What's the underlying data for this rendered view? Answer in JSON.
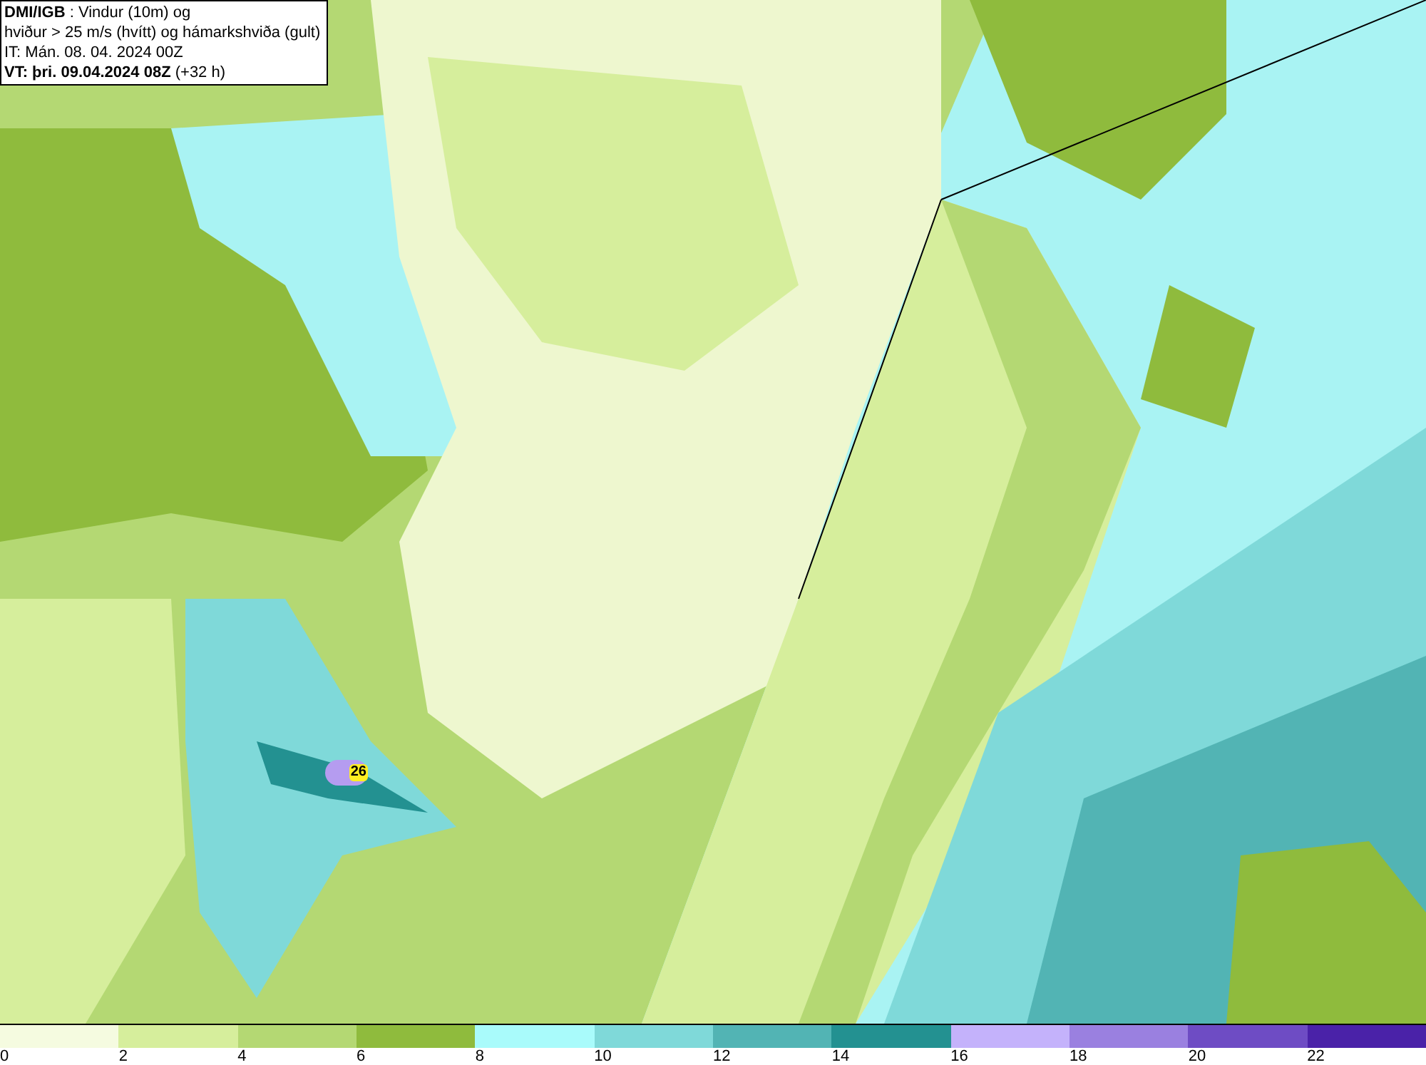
{
  "header": {
    "lines": [
      "**DMI/IGB** : Vindur (10m) og",
      "hviður > 25 m/s (hvítt) og hámarkshviða (gult)",
      "IT: Mán. 08. 04. 2024 00Z",
      "**VT: þri. 09.04.2024 08Z** (+32 h)"
    ]
  },
  "map": {
    "gust_marker": {
      "value": "26"
    }
  },
  "legend": [
    {
      "label": "0",
      "color": "#f5fbe0"
    },
    {
      "label": "2",
      "color": "#d6ee9c"
    },
    {
      "label": "4",
      "color": "#b4d873"
    },
    {
      "label": "6",
      "color": "#8fbb3d"
    },
    {
      "label": "8",
      "color": "#a9fbfb"
    },
    {
      "label": "10",
      "color": "#7fd9d9"
    },
    {
      "label": "12",
      "color": "#52b4b4"
    },
    {
      "label": "14",
      "color": "#239191"
    },
    {
      "label": "16",
      "color": "#c4b2fb"
    },
    {
      "label": "18",
      "color": "#9a80e0"
    },
    {
      "label": "20",
      "color": "#6e4cc4"
    },
    {
      "label": "22",
      "color": "#4a22a8"
    }
  ]
}
